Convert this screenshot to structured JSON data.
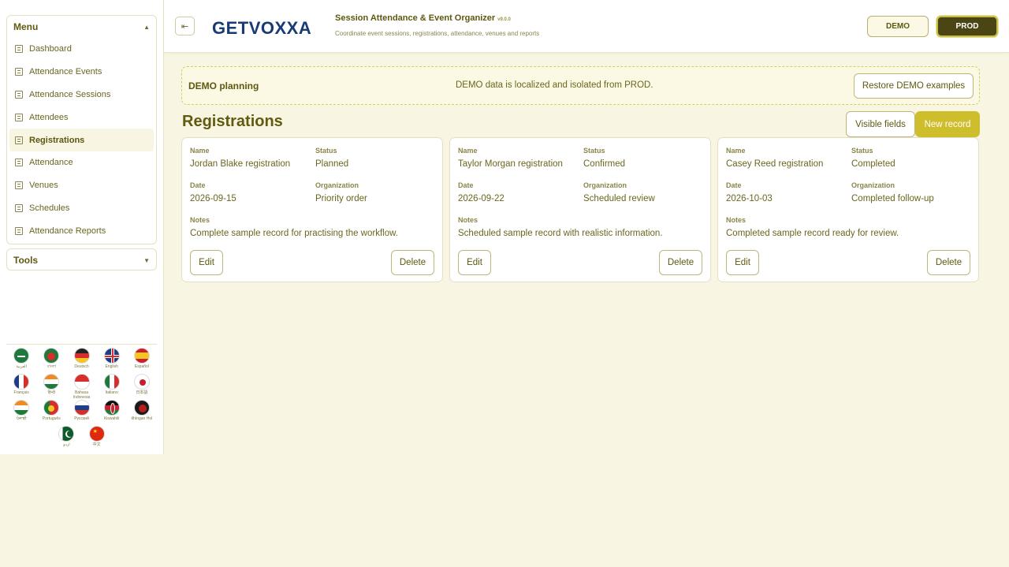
{
  "sidebar": {
    "menu_title": "Menu",
    "tools_title": "Tools",
    "items": [
      {
        "label": "Dashboard"
      },
      {
        "label": "Attendance Events"
      },
      {
        "label": "Attendance Sessions"
      },
      {
        "label": "Attendees"
      },
      {
        "label": "Registrations",
        "active": true
      },
      {
        "label": "Attendance"
      },
      {
        "label": "Venues"
      },
      {
        "label": "Schedules"
      },
      {
        "label": "Attendance Reports"
      }
    ],
    "languages": [
      "العربية",
      "বাংলা",
      "Deutsch",
      "English",
      "Español",
      "Français",
      "हिन्दी",
      "Bahasa Indonesia",
      "Italiano",
      "日本語",
      "ਪੰਜਾਬੀ",
      "Português",
      "Русский",
      "Kiswahili",
      "tlhIngan Hol",
      "اردو",
      "中文"
    ]
  },
  "header": {
    "logo_text": "GETVOXXA",
    "title": "Session Attendance & Event Organizer",
    "version": "v9.0.0",
    "subtitle": "Coordinate event sessions, registrations, attendance, venues and reports",
    "demo_label": "DEMO",
    "prod_label": "PROD"
  },
  "banner": {
    "title": "DEMO planning",
    "message": "DEMO data is localized and isolated from PROD.",
    "restore_label": "Restore DEMO examples"
  },
  "main": {
    "title": "Registrations",
    "visible_fields_label": "Visible fields",
    "new_record_label": "New record",
    "field_labels": {
      "name": "Name",
      "status": "Status",
      "date": "Date",
      "organization": "Organization",
      "notes": "Notes"
    },
    "edit_label": "Edit",
    "delete_label": "Delete",
    "records": [
      {
        "name": "Jordan Blake registration",
        "status": "Planned",
        "date": "2026-09-15",
        "organization": "Priority order",
        "notes": "Complete sample record for practising the workflow."
      },
      {
        "name": "Taylor Morgan registration",
        "status": "Confirmed",
        "date": "2026-09-22",
        "organization": "Scheduled review",
        "notes": "Scheduled sample record with realistic information."
      },
      {
        "name": "Casey Reed registration",
        "status": "Completed",
        "date": "2026-10-03",
        "organization": "Completed follow-up",
        "notes": "Completed sample record ready for review."
      }
    ]
  },
  "colors": {
    "accent": "#cfbe2c",
    "prod_bg": "#4b4514",
    "background": "#f8f5e2",
    "logo": "#183b73"
  }
}
